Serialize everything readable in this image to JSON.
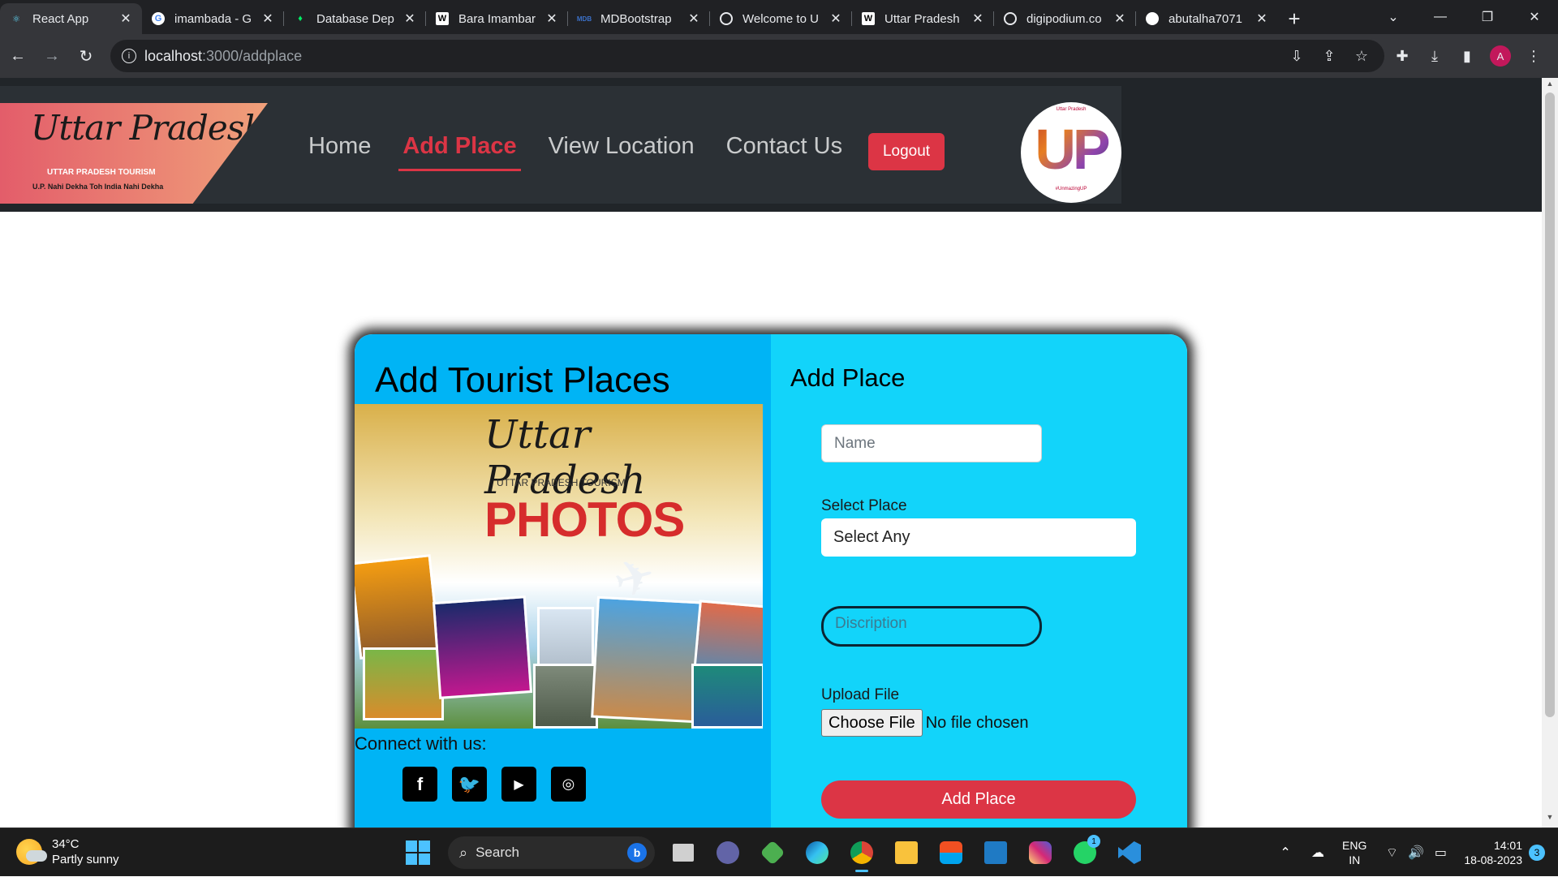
{
  "browser": {
    "tabs": [
      {
        "title": "React App",
        "icon": "react-icon",
        "active": true
      },
      {
        "title": "imambada - G",
        "icon": "google-icon"
      },
      {
        "title": "Database Dep",
        "icon": "mongodb-icon"
      },
      {
        "title": "Bara Imambar",
        "icon": "wikipedia-icon"
      },
      {
        "title": "MDBootstrap",
        "icon": "mdb-icon"
      },
      {
        "title": "Welcome to U",
        "icon": "globe-icon"
      },
      {
        "title": "Uttar Pradesh",
        "icon": "wikipedia-icon"
      },
      {
        "title": "digipodium.co",
        "icon": "globe-icon"
      },
      {
        "title": "abutalha7071",
        "icon": "github-icon"
      }
    ],
    "url_host": "localhost",
    "url_path": ":3000/addplace",
    "profile_initial": "A"
  },
  "site": {
    "logo_script": "Uttar Pradesh",
    "logo_subtitle": "UTTAR PRADESH TOURISM",
    "logo_tagline": "U.P. Nahi Dekha Toh India Nahi Dekha",
    "nav": [
      {
        "label": "Home",
        "active": false
      },
      {
        "label": "Add Place",
        "active": true
      },
      {
        "label": "View Location",
        "active": false
      },
      {
        "label": "Contact Us",
        "active": false
      }
    ],
    "logout_label": "Logout",
    "up_logo_text": "UP",
    "up_logo_hashtag": "#UnmazingUP"
  },
  "card": {
    "title": "Add Tourist Places",
    "photo": {
      "script": "Uttar Pradesh",
      "subtitle": "UTTAR PRADESH TOURISM",
      "headline": "PHOTOS"
    },
    "connect_label": "Connect with us:",
    "socials": [
      "facebook-icon",
      "twitter-icon",
      "youtube-icon",
      "instagram-icon"
    ]
  },
  "form": {
    "title": "Add Place",
    "name_placeholder": "Name",
    "select_label": "Select Place",
    "select_value": "Select Any",
    "description_placeholder": "Discription",
    "upload_label": "Upload File",
    "file_button": "Choose File",
    "file_status": "No file chosen",
    "submit_label": "Add Place"
  },
  "taskbar": {
    "temp": "34°C",
    "weather": "Partly sunny",
    "search_label": "Search",
    "lang_top": "ENG",
    "lang_bottom": "IN",
    "time": "14:01",
    "date": "18-08-2023",
    "notifications": "3",
    "whatsapp_badge": "1"
  }
}
